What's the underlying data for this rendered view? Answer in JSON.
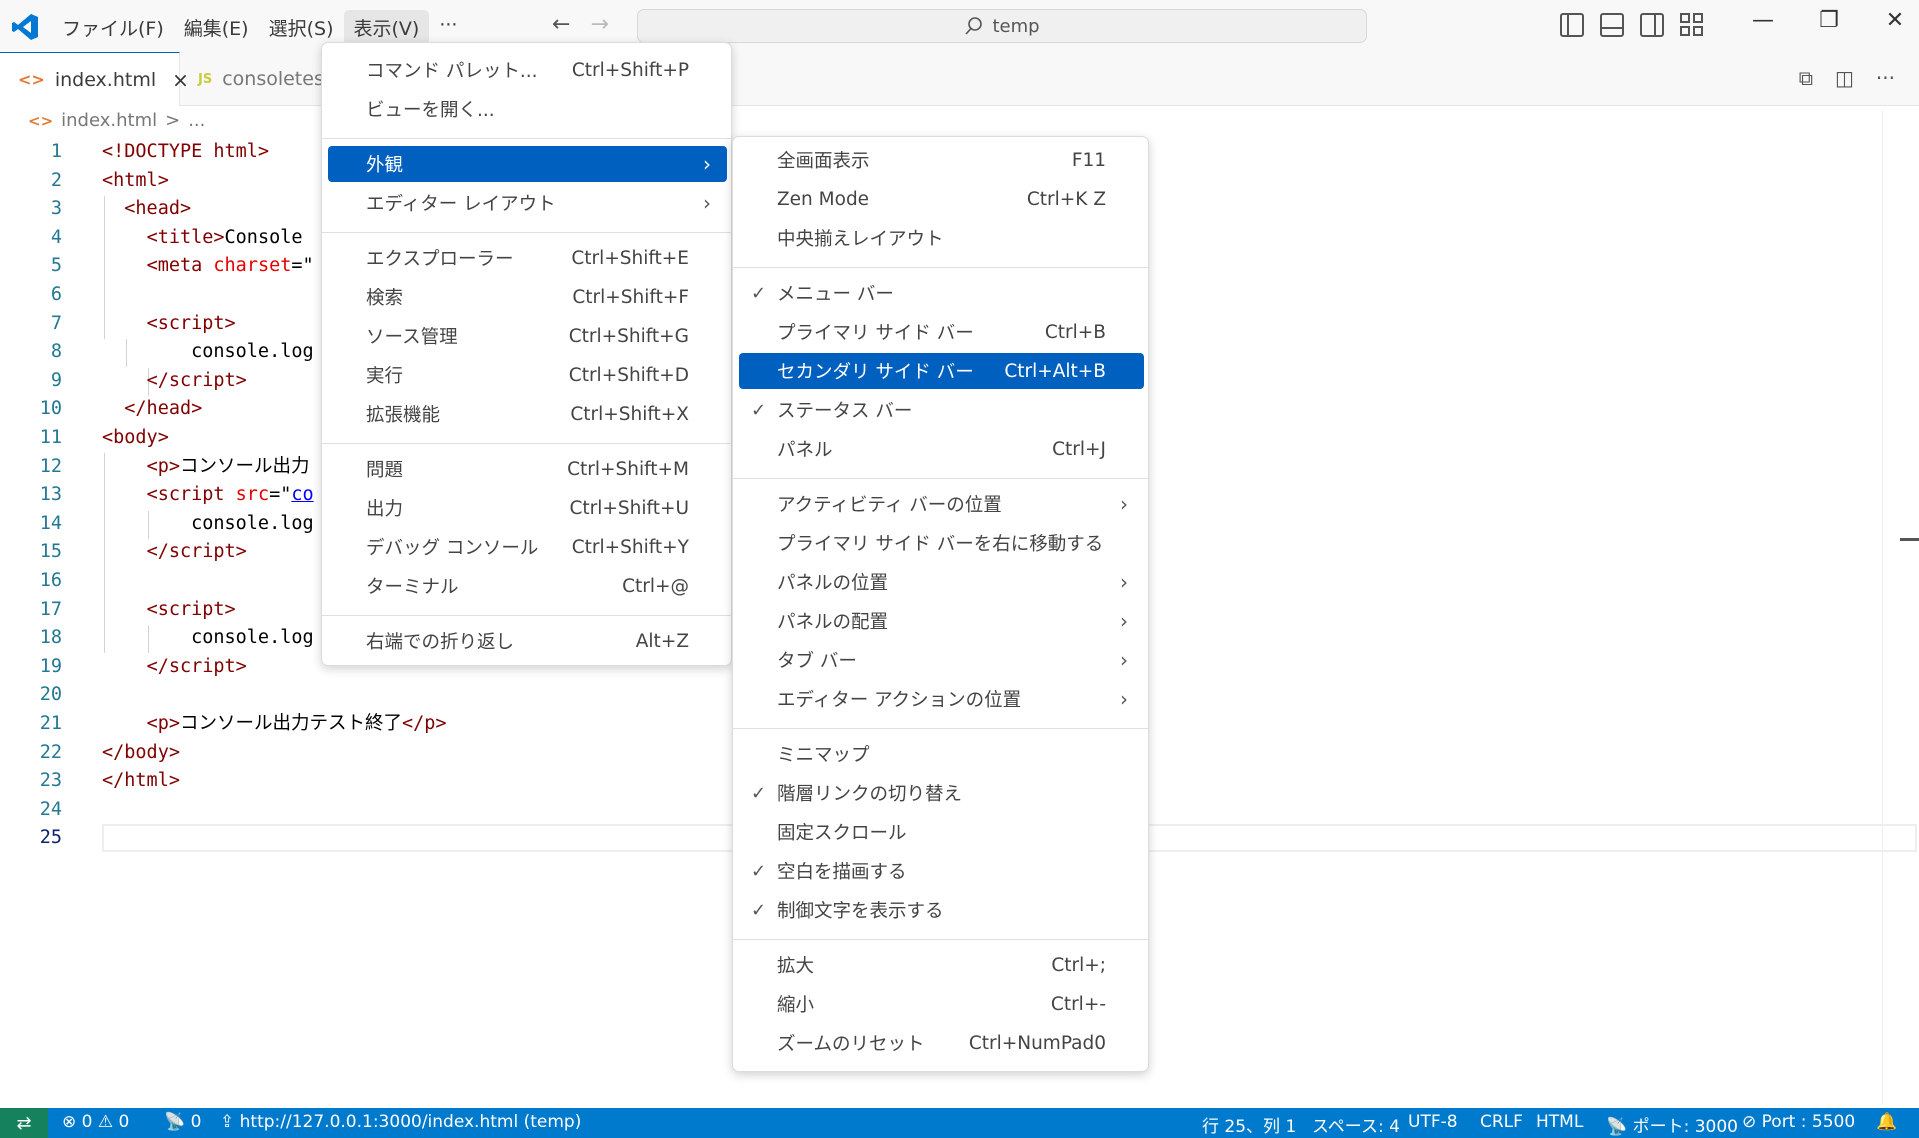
{
  "titlebar": {
    "menus": [
      "ファイル(F)",
      "編集(E)",
      "選択(S)",
      "表示(V)",
      "···"
    ],
    "search_text": "temp",
    "icons": [
      "vscode-logo",
      "back-arrow-icon",
      "forward-arrow-icon",
      "search-icon",
      "toggle-primary-sidebar-icon",
      "toggle-panel-icon",
      "toggle-secondary-sidebar-icon",
      "customize-layout-icon",
      "minimize-icon",
      "restore-icon",
      "close-icon"
    ]
  },
  "tabs": [
    {
      "label": "index.html",
      "icon": "html-file-icon",
      "close": "×"
    },
    {
      "label": "consoletes",
      "icon": "js-file-icon",
      "badge": "JS"
    }
  ],
  "breadcrumb": {
    "file": "index.html",
    "sep": ">",
    "rest": "..."
  },
  "editor": {
    "lines": [
      {
        "n": "1",
        "html": "<span class='tag'>&lt;!DOCTYPE html&gt;</span>"
      },
      {
        "n": "2",
        "html": "<span class='tag'>&lt;html&gt;</span>"
      },
      {
        "n": "3",
        "html": "  <span class='tag'>&lt;head&gt;</span>"
      },
      {
        "n": "4",
        "html": "    <span class='tag'>&lt;title&gt;</span>Console"
      },
      {
        "n": "5",
        "html": "    <span class='tag'>&lt;meta</span> <span class='attr'>charset</span>=\""
      },
      {
        "n": "6",
        "html": ""
      },
      {
        "n": "7",
        "html": "    <span class='tag'>&lt;script&gt;</span>"
      },
      {
        "n": "8",
        "html": "        console.log"
      },
      {
        "n": "9",
        "html": "    <span class='tag'>&lt;/script&gt;</span>"
      },
      {
        "n": "10",
        "html": "  <span class='tag'>&lt;/head&gt;</span>"
      },
      {
        "n": "11",
        "html": "<span class='tag'>&lt;body&gt;</span>"
      },
      {
        "n": "12",
        "html": "    <span class='tag'>&lt;p&gt;</span>コンソール出力"
      },
      {
        "n": "13",
        "html": "    <span class='tag'>&lt;script</span> <span class='attr'>src</span>=\"<span class='str'>co</span>"
      },
      {
        "n": "14",
        "html": "        console.log"
      },
      {
        "n": "15",
        "html": "    <span class='tag'>&lt;/script&gt;</span>"
      },
      {
        "n": "16",
        "html": ""
      },
      {
        "n": "17",
        "html": "    <span class='tag'>&lt;script&gt;</span>"
      },
      {
        "n": "18",
        "html": "        console.log"
      },
      {
        "n": "19",
        "html": "    <span class='tag'>&lt;/script&gt;</span>"
      },
      {
        "n": "20",
        "html": ""
      },
      {
        "n": "21",
        "html": "    <span class='tag'>&lt;p&gt;</span>コンソール出力テスト終了<span class='tag'>&lt;/p&gt;</span>"
      },
      {
        "n": "22",
        "html": "<span class='tag'>&lt;/body&gt;</span>"
      },
      {
        "n": "23",
        "html": "<span class='tag'>&lt;/html&gt;</span>"
      },
      {
        "n": "24",
        "html": ""
      },
      {
        "n": "25",
        "html": ""
      }
    ]
  },
  "view_menu": {
    "groups": [
      [
        {
          "label": "コマンド パレット...",
          "shortcut": "Ctrl+Shift+P"
        },
        {
          "label": "ビューを開く...",
          "shortcut": ""
        }
      ],
      [
        {
          "label": "外観",
          "shortcut": "",
          "submenu": true,
          "highlighted": true
        },
        {
          "label": "エディター レイアウト",
          "shortcut": "",
          "submenu": true
        }
      ],
      [
        {
          "label": "エクスプローラー",
          "shortcut": "Ctrl+Shift+E"
        },
        {
          "label": "検索",
          "shortcut": "Ctrl+Shift+F"
        },
        {
          "label": "ソース管理",
          "shortcut": "Ctrl+Shift+G"
        },
        {
          "label": "実行",
          "shortcut": "Ctrl+Shift+D"
        },
        {
          "label": "拡張機能",
          "shortcut": "Ctrl+Shift+X"
        }
      ],
      [
        {
          "label": "問題",
          "shortcut": "Ctrl+Shift+M"
        },
        {
          "label": "出力",
          "shortcut": "Ctrl+Shift+U"
        },
        {
          "label": "デバッグ コンソール",
          "shortcut": "Ctrl+Shift+Y"
        },
        {
          "label": "ターミナル",
          "shortcut": "Ctrl+@"
        }
      ],
      [
        {
          "label": "右端での折り返し",
          "shortcut": "Alt+Z"
        }
      ]
    ]
  },
  "appearance_menu": {
    "groups": [
      [
        {
          "label": "全画面表示",
          "shortcut": "F11"
        },
        {
          "label": "Zen Mode",
          "shortcut": "Ctrl+K Z"
        },
        {
          "label": "中央揃えレイアウト",
          "shortcut": ""
        }
      ],
      [
        {
          "label": "メニュー バー",
          "shortcut": "",
          "checked": true
        },
        {
          "label": "プライマリ サイド バー",
          "shortcut": "Ctrl+B"
        },
        {
          "label": "セカンダリ サイド バー",
          "shortcut": "Ctrl+Alt+B",
          "highlighted": true
        },
        {
          "label": "ステータス バー",
          "shortcut": "",
          "checked": true
        },
        {
          "label": "パネル",
          "shortcut": "Ctrl+J"
        }
      ],
      [
        {
          "label": "アクティビティ バーの位置",
          "shortcut": "",
          "submenu": true
        },
        {
          "label": "プライマリ サイド バーを右に移動する",
          "shortcut": ""
        },
        {
          "label": "パネルの位置",
          "shortcut": "",
          "submenu": true
        },
        {
          "label": "パネルの配置",
          "shortcut": "",
          "submenu": true
        },
        {
          "label": "タブ バー",
          "shortcut": "",
          "submenu": true
        },
        {
          "label": "エディター アクションの位置",
          "shortcut": "",
          "submenu": true
        }
      ],
      [
        {
          "label": "ミニマップ",
          "shortcut": ""
        },
        {
          "label": "階層リンクの切り替え",
          "shortcut": "",
          "checked": true
        },
        {
          "label": "固定スクロール",
          "shortcut": ""
        },
        {
          "label": "空白を描画する",
          "shortcut": "",
          "checked": true
        },
        {
          "label": "制御文字を表示する",
          "shortcut": "",
          "checked": true
        }
      ],
      [
        {
          "label": "拡大",
          "shortcut": "Ctrl+;"
        },
        {
          "label": "縮小",
          "shortcut": "Ctrl+-"
        },
        {
          "label": "ズームのリセット",
          "shortcut": "Ctrl+NumPad0"
        }
      ]
    ]
  },
  "statusbar": {
    "remote": "⇄",
    "errors": "⊗ 0 ⚠ 0",
    "ports": "📡 0",
    "live_url": "⇪ http://127.0.0.1:3000/index.html (temp)",
    "position": "行 25、列 1",
    "spaces": "スペース: 4",
    "encoding": "UTF-8",
    "eol": "CRLF",
    "language": "HTML",
    "port_forward": "📡 ポート: 3000",
    "live_port": "⊘ Port : 5500",
    "bell": "🔔"
  }
}
